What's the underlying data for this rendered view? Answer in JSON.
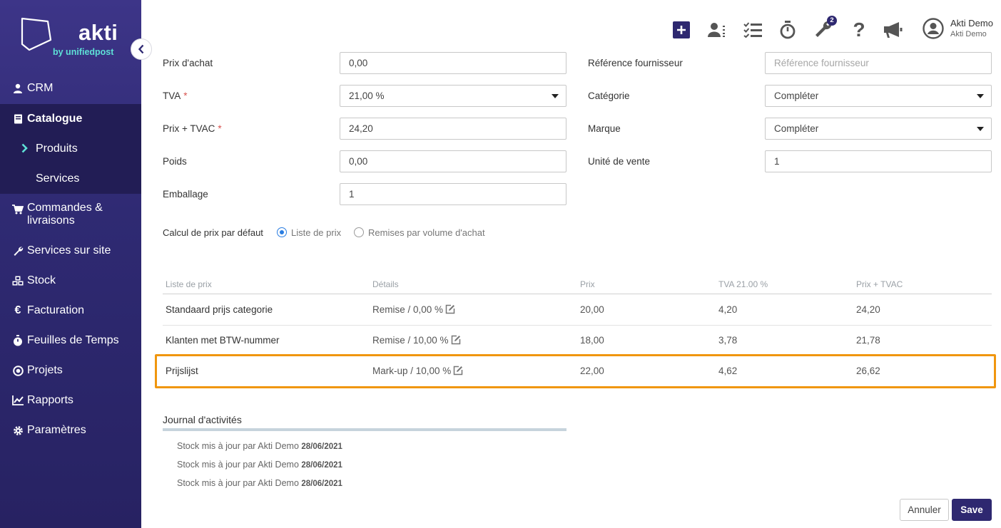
{
  "brand": {
    "name": "akti",
    "tagline": "by unifiedpost"
  },
  "sidebar": {
    "items": [
      {
        "label": "CRM",
        "icon": "user-icon"
      },
      {
        "label": "Catalogue",
        "icon": "book-icon"
      },
      {
        "label": "Produits",
        "icon": "chevron-right-icon"
      },
      {
        "label": "Services"
      },
      {
        "label": "Commandes &",
        "label2": "livraisons",
        "icon": "cart-icon"
      },
      {
        "label": "Services sur site",
        "icon": "wrench-icon"
      },
      {
        "label": "Stock",
        "icon": "cubes-icon"
      },
      {
        "label": "Facturation",
        "icon": "euro-icon"
      },
      {
        "label": "Feuilles de Temps",
        "icon": "stopwatch-icon"
      },
      {
        "label": "Projets",
        "icon": "target-icon"
      },
      {
        "label": "Rapports",
        "icon": "line-chart-icon"
      },
      {
        "label": "Paramètres",
        "icon": "gear-icon"
      }
    ]
  },
  "topbar": {
    "notification_count": "2",
    "user_name": "Akti Demo",
    "user_company": "Akti Demo"
  },
  "form": {
    "purchase_price": {
      "label": "Prix d'achat",
      "value": "0,00"
    },
    "supplier_ref": {
      "label": "Référence fournisseur",
      "placeholder": "Référence fournisseur"
    },
    "vat": {
      "label": "TVA",
      "value": "21,00 %"
    },
    "category": {
      "label": "Catégorie",
      "value": "Compléter"
    },
    "price_incl": {
      "label": "Prix + TVAC",
      "value": "24,20"
    },
    "brand": {
      "label": "Marque",
      "value": "Compléter"
    },
    "weight": {
      "label": "Poids",
      "value": "0,00"
    },
    "sales_unit": {
      "label": "Unité de vente",
      "value": "1"
    },
    "packaging": {
      "label": "Emballage",
      "value": "1"
    },
    "required_mark": "*",
    "pricing_default": {
      "label": "Calcul de prix par défaut",
      "option1": "Liste de prix",
      "option2": "Remises par volume d'achat",
      "selected": "Liste de prix"
    }
  },
  "pricelist": {
    "headers": [
      "Liste de prix",
      "Détails",
      "Prix",
      "TVA 21.00 %",
      "Prix + TVAC"
    ],
    "rows": [
      {
        "name": "Standaard prijs categorie",
        "details": "Remise / 0,00 %",
        "price": "20,00",
        "vat": "4,20",
        "total": "24,20"
      },
      {
        "name": "Klanten met BTW-nummer",
        "details": "Remise / 10,00 %",
        "price": "18,00",
        "vat": "3,78",
        "total": "21,78"
      },
      {
        "name": "Prijslijst",
        "details": "Mark-up / 10,00 %",
        "price": "22,00",
        "vat": "4,62",
        "total": "26,62"
      }
    ]
  },
  "journal": {
    "title": "Journal d'activités",
    "entries": [
      {
        "text": "Stock mis à jour par Akti Demo",
        "date": "28/06/2021"
      },
      {
        "text": "Stock mis à jour par Akti Demo",
        "date": "28/06/2021"
      },
      {
        "text": "Stock mis à jour par Akti Demo",
        "date": "28/06/2021"
      }
    ]
  },
  "buttons": {
    "cancel": "Annuler",
    "save": "Save"
  },
  "colors": {
    "sidebar": "#2f2a73",
    "accent": "#2e2870",
    "highlight": "#f0960e",
    "teal": "#5ee0d6"
  }
}
